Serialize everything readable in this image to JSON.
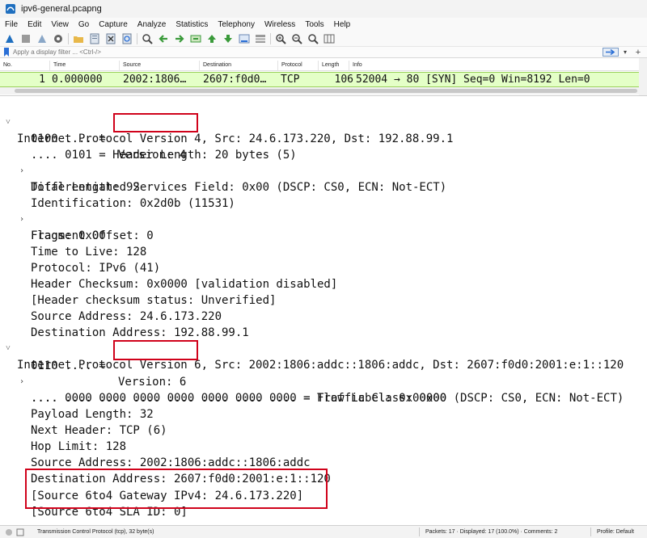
{
  "window": {
    "title": "ipv6-general.pcapng"
  },
  "menu": [
    "File",
    "Edit",
    "View",
    "Go",
    "Capture",
    "Analyze",
    "Statistics",
    "Telephony",
    "Wireless",
    "Tools",
    "Help"
  ],
  "toolbar": {
    "icons": [
      "shark-fin-start-icon",
      "stop-icon",
      "restart-icon",
      "options-gear-icon",
      "open-folder-icon",
      "save-file-icon",
      "close-file-icon",
      "reload-icon",
      "find-magnifier-icon",
      "go-back-icon",
      "go-forward-icon",
      "go-to-packet-icon",
      "go-first-icon",
      "go-last-icon",
      "autoscroll-icon",
      "colorize-icon",
      "zoom-in-icon",
      "zoom-out-icon",
      "zoom-normal-icon",
      "resize-columns-icon"
    ]
  },
  "filter": {
    "placeholder": "Apply a display filter ... <Ctrl-/>"
  },
  "packet_list": {
    "columns": [
      "No.",
      "Time",
      "Source",
      "Destination",
      "Protocol",
      "Length",
      "Info"
    ],
    "row": {
      "no": "1",
      "time": "0.000000",
      "source": "2002:1806…",
      "destination": "2607:f0d0…",
      "protocol": "TCP",
      "length": "106",
      "info": "52004 → 80 [SYN] Seq=0 Win=8192 Len=0"
    }
  },
  "details": {
    "ipv4_header": "Internet Protocol Version 4, Src: 24.6.173.220, Dst: 192.88.99.1",
    "ipv4_version_prefix": "0100 .... = ",
    "ipv4_version": "Version: 4",
    "ipv4_hdr_len": ".... 0101 = Header Length: 20 bytes (5)",
    "ipv4_dsfield": "Differentiated Services Field: 0x00 (DSCP: CS0, ECN: Not-ECT)",
    "ipv4_total_len": "Total Length: 92",
    "ipv4_id": "Identification: 0x2d0b (11531)",
    "ipv4_flags": "Flags: 0x00",
    "ipv4_frag": "Fragment Offset: 0",
    "ipv4_ttl": "Time to Live: 128",
    "ipv4_proto": "Protocol: IPv6 (41)",
    "ipv4_checksum": "Header Checksum: 0x0000 [validation disabled]",
    "ipv4_checksum_status": "[Header checksum status: Unverified]",
    "ipv4_src": "Source Address: 24.6.173.220",
    "ipv4_dst": "Destination Address: 192.88.99.1",
    "ipv6_header": "Internet Protocol Version 6, Src: 2002:1806:addc::1806:addc, Dst: 2607:f0d0:2001:e:1::120",
    "ipv6_version_prefix": "0110 .... = ",
    "ipv6_version": "Version: 6",
    "ipv6_tclass": ".... 0000 0000 .... .... .... .... .... = Traffic Class: 0x00 (DSCP: CS0, ECN: Not-ECT)",
    "ipv6_flow": ".... .... .... 0000 0000 0000 0000 0000 = Flow Label: 0x00000",
    "ipv6_plen": "Payload Length: 32",
    "ipv6_nxt": "Next Header: TCP (6)",
    "ipv6_hlim": "Hop Limit: 128",
    "ipv6_src": "Source Address: 2002:1806:addc::1806:addc",
    "ipv6_dst": "Destination Address: 2607:f0d0:2001:e:1::120",
    "ipv6_6to4_gw": "[Source 6to4 Gateway IPv4: 24.6.173.220]",
    "ipv6_6to4_sla": "[Source 6to4 SLA ID: 0]"
  },
  "status": {
    "field": "Transmission Control Protocol (tcp), 32 byte(s)",
    "packets": "Packets: 17 · Displayed: 17 (100.0%) · Comments: 2",
    "profile": "Profile: Default"
  },
  "colors": {
    "packet_row_bg": "#e4ffc7",
    "highlight_box": "#d0021b"
  }
}
